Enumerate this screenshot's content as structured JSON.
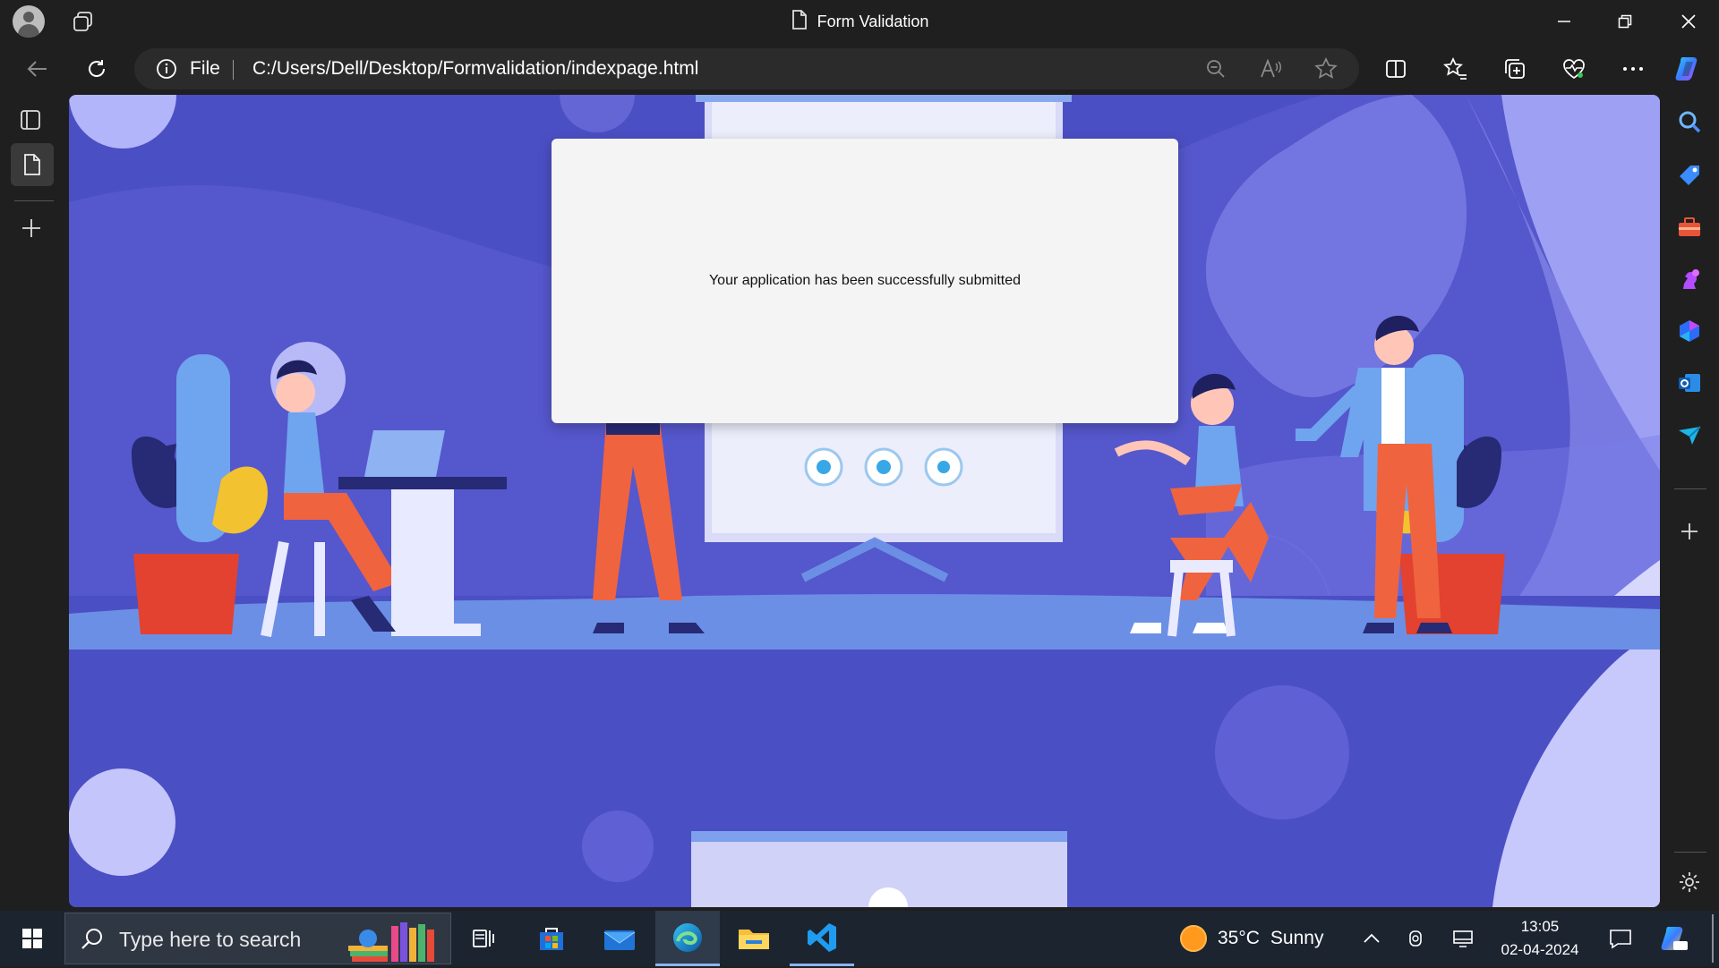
{
  "window": {
    "title": "Form Validation",
    "minimize_icon": "minimize-icon",
    "restore_icon": "restore-icon",
    "close_icon": "close-icon"
  },
  "navbar": {
    "protocol_label": "File",
    "url": "C:/Users/Dell/Desktop/Formvalidation/indexpage.html"
  },
  "page": {
    "message": "Your application has been successfully submitted",
    "colors": {
      "background_primary": "#4b4fc4",
      "floor": "#6c8fe6",
      "accent_orange": "#f0633f",
      "modal_bg": "#f4f4f4"
    }
  },
  "taskbar": {
    "search_placeholder": "Type here to search",
    "weather_temp": "35°C",
    "weather_condition": "Sunny",
    "time": "13:05",
    "date": "02-04-2024"
  }
}
